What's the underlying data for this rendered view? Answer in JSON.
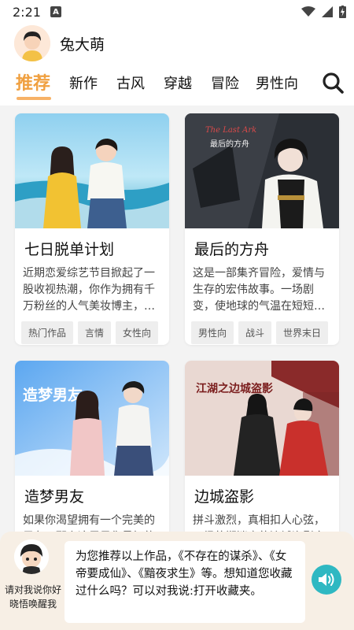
{
  "status": {
    "time": "2:21",
    "app_letter": "A"
  },
  "profile": {
    "username": "兔大萌"
  },
  "tabs": [
    {
      "label": "推荐",
      "active": true
    },
    {
      "label": "新作",
      "active": false
    },
    {
      "label": "古风",
      "active": false
    },
    {
      "label": "穿越",
      "active": false
    },
    {
      "label": "冒险",
      "active": false
    },
    {
      "label": "男性向",
      "active": false
    }
  ],
  "cards": [
    {
      "title": "七日脱单计划",
      "desc": "近期恋爱综艺节目掀起了一股收视热潮，你作为拥有千万粉丝的人气美妆博主，…",
      "tags": [
        "热门作品",
        "言情",
        "女性向"
      ],
      "cover_text": ""
    },
    {
      "title": "最后的方舟",
      "desc": "这是一部集齐冒险，爱情与生存的宏伟故事。一场剧变，使地球的气温在短短…",
      "tags": [
        "男性向",
        "战斗",
        "世界末日"
      ],
      "cover_text": "The Last Ark",
      "cover_sub": "最后的方舟"
    },
    {
      "title": "造梦男友",
      "desc": "如果你渴望拥有一个完美的男友，那么这里是你最好的选择…",
      "tags": [],
      "cover_text": "造梦男友"
    },
    {
      "title": "边城盗影",
      "desc": "拼斗激烈，真相扣人心弦，一场扑朔迷离的边城盗影之旅…",
      "tags": [],
      "cover_text": "江湖之边城盗影"
    }
  ],
  "assistant": {
    "hint": "请对我说你好晓悟唤醒我",
    "message": "为您推荐以上作品，《不存在的谋杀》、《女帝要成仙》、《黯夜求生》等。想知道您收藏过什么吗？可以对我说:打开收藏夹。"
  },
  "colors": {
    "accent": "#f0a040",
    "speaker": "#2fb8c2"
  }
}
